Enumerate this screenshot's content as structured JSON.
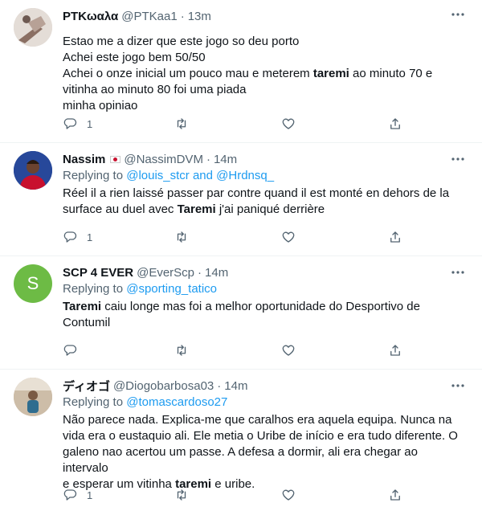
{
  "tweets": [
    {
      "name": "PTKωαλα",
      "handle": "@PTKaa1",
      "dot": "·",
      "time": "13m",
      "lines": [
        "Estao me a dizer que este jogo so deu porto",
        "Achei este jogo bem 50/50"
      ],
      "line3_before": "Achei o onze inicial um pouco mau e meterem ",
      "line3_bold": "taremi",
      "line3_after": " ao minuto 70 e",
      "line4": "vitinha ao minuto 80 foi uma piada",
      "line5": "minha opiniao",
      "reply_count": "1",
      "avatar_colors": [
        "#d9d0c9",
        "#8a6f63"
      ]
    },
    {
      "name": "Nassim",
      "handle": "@NassimDVM",
      "dot": "·",
      "time": "14m",
      "replying_prefix": "Replying to ",
      "replying_to": "@louis_stcr and @Hrdnsq_",
      "line1": "Réel il a rien laissé passer par contre quand il est monté en dehors de la",
      "line2_before": "surface au duel avec ",
      "line2_bold": "Taremi",
      "line2_after": " j'ai paniqué derrière",
      "reply_count": "1",
      "avatar_colors": [
        "#1e3b8c",
        "#c8102e"
      ]
    },
    {
      "name": "SCP 4 EVER",
      "handle": "@EverScp",
      "dot": "·",
      "time": "14m",
      "avatar_letter": "S",
      "replying_prefix": "Replying to ",
      "replying_to": "@sporting_tatico",
      "line1_bold": "Taremi",
      "line1_after": " caiu longe mas foi a melhor oportunidade do Desportivo de",
      "line2": "Contumil",
      "reply_count": "",
      "avatar_colors": [
        "#6dbb45"
      ]
    },
    {
      "name": "ディオゴ",
      "handle": "@Diogobarbosa03",
      "dot": "·",
      "time": "14m",
      "replying_prefix": "Replying to ",
      "replying_to": "@tomascardoso27",
      "line1": "Não parece nada. Explica-me que caralhos era aquela equipa. Nunca na",
      "line2": "vida era o eustaquio ali. Ele metia o Uribe de início e era tudo diferente. O",
      "line3": "galeno nao acertou um passe. A defesa a dormir, ali era chegar ao intervalo",
      "line4_before": "e esperar um vitinha ",
      "line4_bold": "taremi",
      "line4_after": " e uribe.",
      "reply_count": "1",
      "avatar_colors": [
        "#c9b8a3",
        "#2f6d8f"
      ]
    }
  ]
}
